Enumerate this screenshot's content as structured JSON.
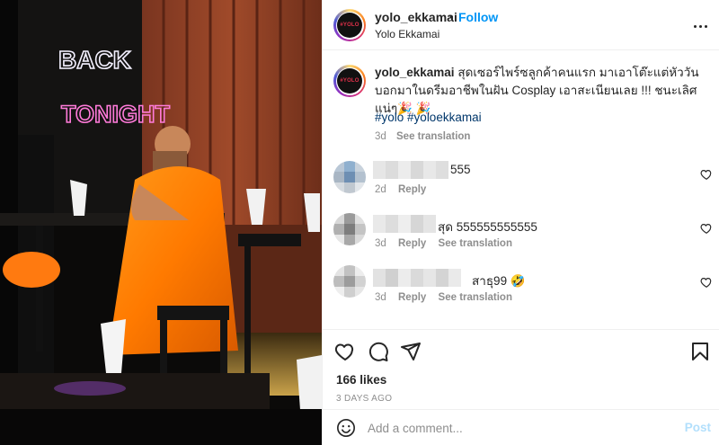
{
  "photo": {
    "neon_line1": "BACK",
    "neon_line2": "TONIGHT"
  },
  "header": {
    "username": "yolo_ekkamai",
    "separator": "•",
    "follow_label": "Follow",
    "location": "Yolo Ekkamai",
    "avatar_logo": "#YOLO"
  },
  "caption": {
    "username": "yolo_ekkamai",
    "text": "สุดเซอร์ไพร์ซลูกค้าคนแรก มาเอาโต๊ะแต่หัววัน บอกมาในดรีมอาชีพในฝัน Cosplay เอาสะเนียนเลย !!! ชนะเลิศแน่ๆ🎉 🎉",
    "hashtags": [
      "#yolo",
      "#yoloekkamai"
    ],
    "time": "3d",
    "see_translation": "See translation"
  },
  "comments": [
    {
      "text": "555",
      "time": "2d",
      "reply": "Reply",
      "see_translation": ""
    },
    {
      "text": "สุด 555555555555",
      "time": "3d",
      "reply": "Reply",
      "see_translation": "See translation"
    },
    {
      "text": "สาธุ99 🤣",
      "time": "3d",
      "reply": "Reply",
      "see_translation": "See translation"
    }
  ],
  "actions": {
    "like_icon": "heart-icon",
    "comment_icon": "comment-icon",
    "share_icon": "share-icon",
    "save_icon": "bookmark-icon"
  },
  "likes": "166 likes",
  "posted_ago": "3 DAYS AGO",
  "add_comment": {
    "placeholder": "Add a comment...",
    "post_label": "Post"
  },
  "colors": {
    "link_blue": "#0095f6",
    "hashtag": "#00376b",
    "muted": "#8e8e8e",
    "post_disabled": "#b2dffc"
  }
}
